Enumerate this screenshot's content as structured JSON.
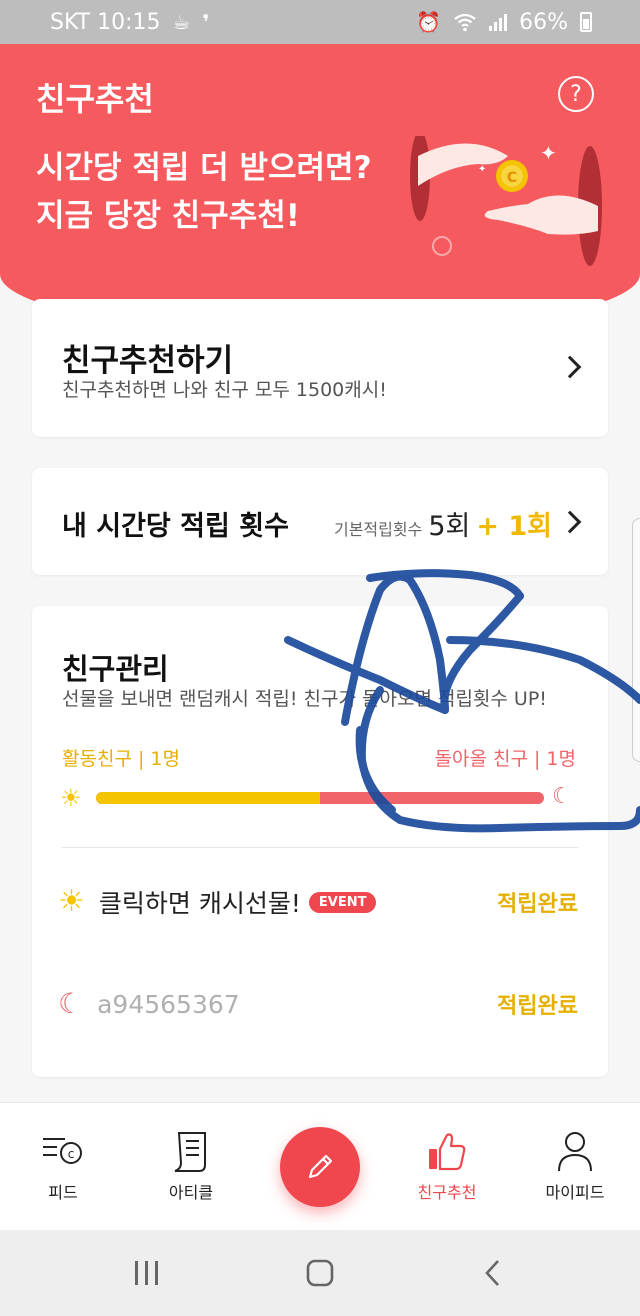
{
  "status_bar": {
    "carrier_time": "SKT 10:15",
    "battery": "66%",
    "icons": [
      "coffee-icon",
      "comma-icon",
      "alarm-icon",
      "wifi-icon",
      "signal-icon",
      "battery-icon"
    ]
  },
  "header": {
    "title": "친구추천",
    "help_icon": "?",
    "headline_line1": "시간당 적립 더 받으려면?",
    "headline_line2": "지금 당장 친구추천!",
    "coin_letter": "C"
  },
  "recommend_card": {
    "title": "친구추천하기",
    "subtitle": "친구추천하면 나와 친구 모두 1500캐시!"
  },
  "count_card": {
    "title": "내 시간당 적립 횟수",
    "base_label": "기본적립횟수",
    "base_value": "5회",
    "bonus_value": "+ 1회"
  },
  "manage_card": {
    "title": "친구관리",
    "subtitle": "선물을 보내면 랜덤캐시 적립! 친구가 돌아오면 적립횟수 UP!",
    "active_label": "활동친구 | 1명",
    "return_label": "돌아올 친구 | 1명",
    "active_ratio": 0.5,
    "rows": [
      {
        "text": "클릭하면 캐시선물!",
        "badge": "EVENT",
        "status": "적립완료"
      },
      {
        "text": "a94565367",
        "status": "적립완료"
      }
    ]
  },
  "bottom_nav": {
    "items": [
      {
        "label": "피드"
      },
      {
        "label": "아티클"
      },
      {
        "label": "친구추천"
      },
      {
        "label": "마이피드"
      }
    ],
    "active": "친구추천"
  },
  "colors": {
    "brand_red": "#f55a5f",
    "accent_yellow": "#f5c400",
    "badge_red": "#f0464d",
    "scribble_blue": "#1c4a9c"
  }
}
